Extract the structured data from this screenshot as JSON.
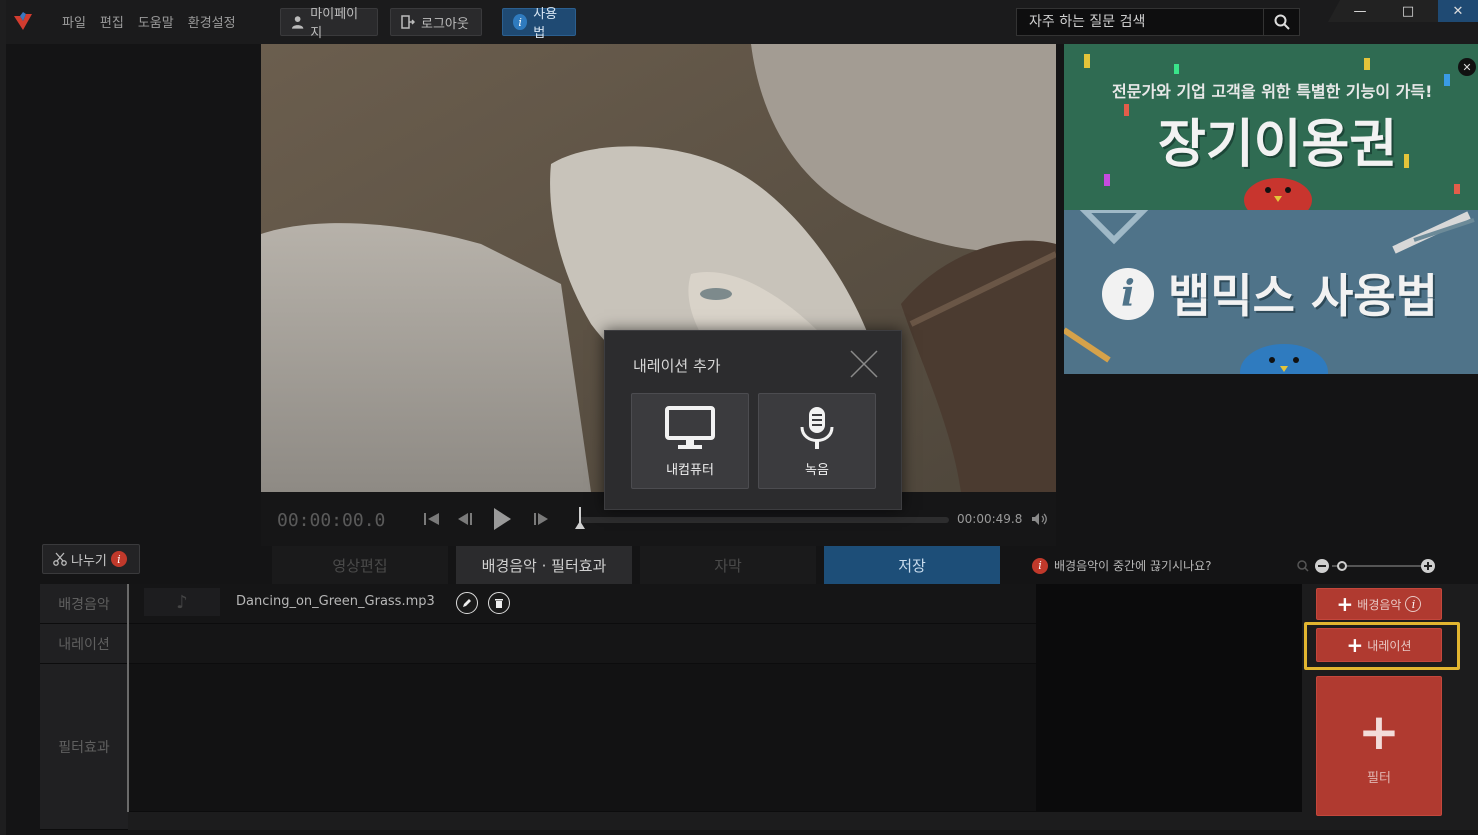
{
  "menu": [
    "파일",
    "편집",
    "도움말",
    "환경설정"
  ],
  "toolbar": {
    "mypage": "마이페이지",
    "logout": "로그아웃",
    "help": "사용법"
  },
  "search": {
    "placeholder": "자주 하는 질문 검색",
    "icon": "search-icon"
  },
  "window": {
    "minimize": "—",
    "maximize": "□",
    "close": "✕"
  },
  "player": {
    "current_time": "00:00:00.0",
    "end_time": "00:00:49.8"
  },
  "dialog": {
    "title": "내레이션 추가",
    "options": [
      {
        "label": "내컴퓨터",
        "icon": "monitor-icon"
      },
      {
        "label": "녹음",
        "icon": "microphone-icon"
      }
    ]
  },
  "ad": {
    "line1": "전문가와 기업 고객을 위한 특별한 기능이 가득!",
    "line2": "장기이용권",
    "line3": "뱁믹스 사용법"
  },
  "split_label": "나누기",
  "tabs": [
    "영상편집",
    "배경음악 · 필터효과",
    "자막",
    "저장"
  ],
  "notice": "배경음악이 중간에 끊기시나요?",
  "timeline": {
    "rows": [
      "배경음악",
      "내레이션",
      "필터효과"
    ],
    "music_file": "Dancing_on_Green_Grass.mp3"
  },
  "actions": {
    "add_music": "배경음악",
    "add_narration": "내레이션",
    "add_filter": "필터"
  },
  "colors": {
    "accent_red": "#b03a30",
    "save_blue": "#1d4e78",
    "highlight": "#e1b530"
  }
}
